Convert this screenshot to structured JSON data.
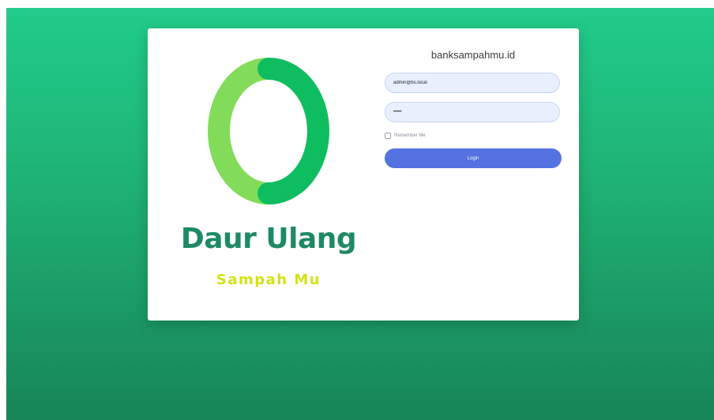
{
  "brand": {
    "title": "Daur Ulang",
    "subtitle": "Sampah Mu",
    "colors": {
      "title": "#1d8a64",
      "subtitle": "#d4e118",
      "ring_light": "#82dc5a",
      "ring_dark": "#0fbd61"
    }
  },
  "login": {
    "site_name": "banksampahmu.id",
    "email_value": "admin@bs.local",
    "password_value": "•••••",
    "remember_label": "Remember Me",
    "remember_checked": false,
    "button_label": "Login",
    "button_color": "#5473e0"
  },
  "background": {
    "gradient_top": "#21cb8a",
    "gradient_bottom": "#178556"
  }
}
